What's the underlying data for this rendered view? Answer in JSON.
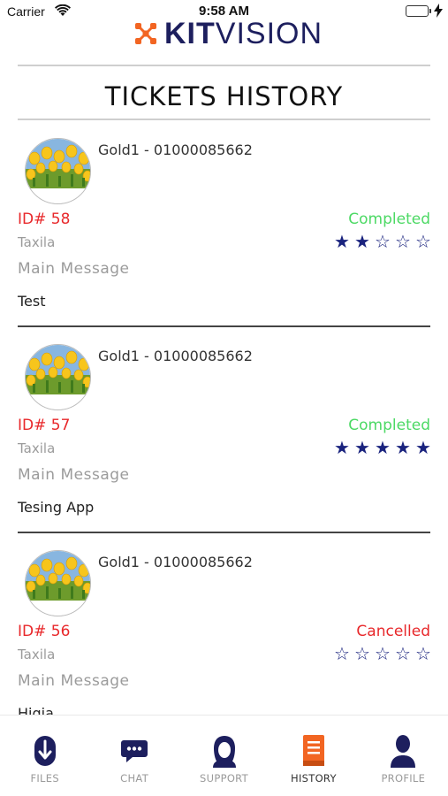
{
  "status_bar": {
    "carrier": "Carrier",
    "time": "9:58 AM",
    "battery_color": "#4cd964"
  },
  "brand": {
    "kit": "KIT",
    "vision": "VISION",
    "mark_color": "#f26522",
    "text_color": "#1d1f5e"
  },
  "page": {
    "title": "TICKETS HISTORY"
  },
  "tickets": [
    {
      "user": "Gold1 - 01000085662",
      "id": "ID# 58",
      "status": "Completed",
      "status_color": "#4cd964",
      "city": "Taxila",
      "rating": 2,
      "message_label": "Main Message",
      "message": "Test"
    },
    {
      "user": "Gold1 - 01000085662",
      "id": "ID# 57",
      "status": "Completed",
      "status_color": "#4cd964",
      "city": "Taxila",
      "rating": 5,
      "message_label": "Main Message",
      "message": "Tesing App"
    },
    {
      "user": "Gold1 - 01000085662",
      "id": "ID# 56",
      "status": "Cancelled",
      "status_color": "#e8282b",
      "city": "Taxila",
      "rating": 0,
      "message_label": "Main Message",
      "message": "Higia"
    }
  ],
  "tabbar": {
    "items": [
      {
        "label": "FILES",
        "icon": "files-download-icon"
      },
      {
        "label": "CHAT",
        "icon": "chat-bubble-icon"
      },
      {
        "label": "SUPPORT",
        "icon": "support-agent-icon"
      },
      {
        "label": "HISTORY",
        "icon": "history-book-icon",
        "active": true
      },
      {
        "label": "PROFILE",
        "icon": "profile-person-icon"
      }
    ],
    "active_color": "#f26522",
    "icon_color": "#1d1f5e"
  }
}
